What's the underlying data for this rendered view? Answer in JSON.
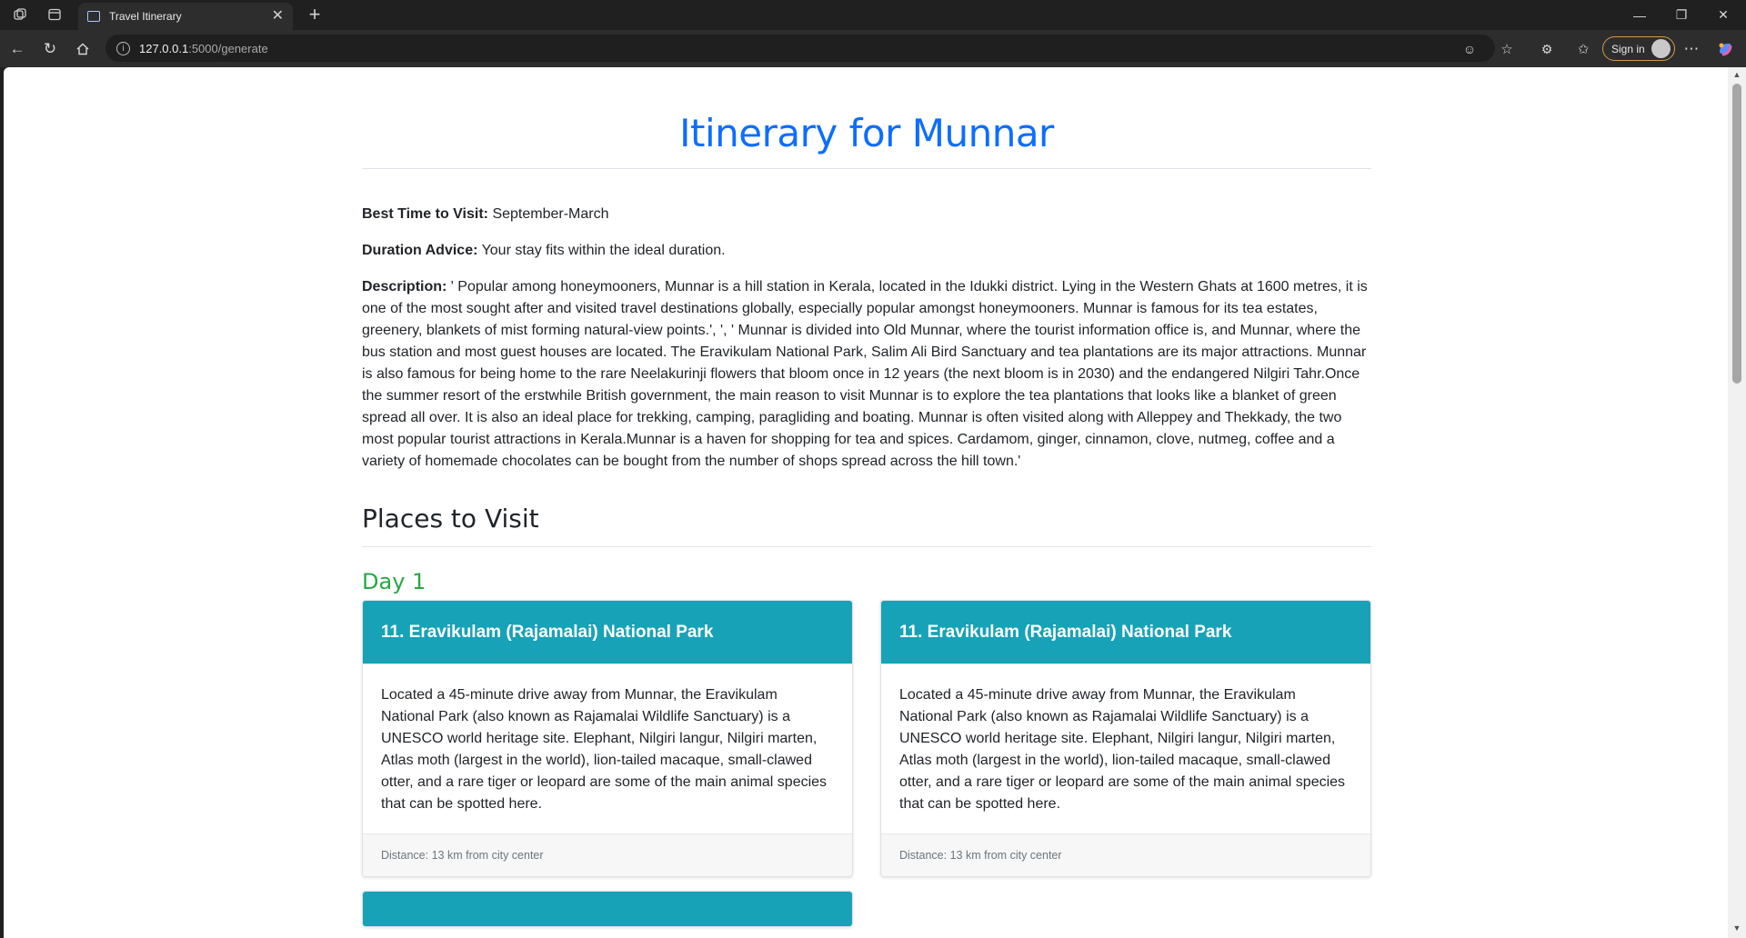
{
  "browser": {
    "tab_title": "Travel Itinerary",
    "url_host": "127.0.0.1",
    "url_path": ":5000/generate",
    "sign_in_label": "Sign in"
  },
  "page": {
    "title": "Itinerary for Munnar",
    "best_time_label": "Best Time to Visit:",
    "best_time_value": " September-March",
    "duration_label": "Duration Advice:",
    "duration_value": " Your stay fits within the ideal duration.",
    "description_label": "Description:",
    "description_value": " ' Popular among honeymooners, Munnar is a hill station in Kerala, located in the Idukki district. Lying in the Western Ghats at 1600 metres, it is one of the most sought after and visited travel destinations globally, especially popular amongst honeymooners. Munnar is famous for its tea estates, greenery, blankets of mist forming natural-view points.', ', ' Munnar is divided into Old Munnar, where the tourist information office is, and Munnar, where the bus station and most guest houses are located. The Eravikulam National Park, Salim Ali Bird Sanctuary and tea plantations are its major attractions. Munnar is also famous for being home to the rare Neelakurinji flowers that bloom once in 12 years (the next bloom is in 2030) and the endangered Nilgiri Tahr.Once the summer resort of the erstwhile British government, the main reason to visit Munnar is to explore the tea plantations that looks like a blanket of green spread all over. It is also an ideal place for trekking, camping, paragliding and boating. Munnar is often visited along with Alleppey and Thekkady, the two most popular tourist attractions in Kerala.Munnar is a haven for shopping for tea and spices. Cardamom, ginger, cinnamon, clove, nutmeg, coffee and a variety of homemade chocolates can be bought from the number of shops spread across the hill town.'",
    "places_heading": "Places to Visit",
    "day_label": "Day 1",
    "cards": [
      {
        "title": "11. Eravikulam (Rajamalai) National Park",
        "body": "Located a 45-minute drive away from Munnar, the Eravikulam National Park (also known as Rajamalai Wildlife Sanctuary) is a UNESCO world heritage site. Elephant, Nilgiri langur, Nilgiri marten, Atlas moth (largest in the world), lion-tailed macaque, small-clawed otter, and a rare tiger or leopard are some of the main animal species that can be spotted here.",
        "footer": "Distance: 13 km from city center"
      },
      {
        "title": "11. Eravikulam (Rajamalai) National Park",
        "body": "Located a 45-minute drive away from Munnar, the Eravikulam National Park (also known as Rajamalai Wildlife Sanctuary) is a UNESCO world heritage site. Elephant, Nilgiri langur, Nilgiri marten, Atlas moth (largest in the world), lion-tailed macaque, small-clawed otter, and a rare tiger or leopard are some of the main animal species that can be spotted here.",
        "footer": "Distance: 13 km from city center"
      }
    ]
  },
  "colors": {
    "title_blue": "#0d6efd",
    "day_green": "#28a745",
    "card_header": "#17a2b8"
  }
}
